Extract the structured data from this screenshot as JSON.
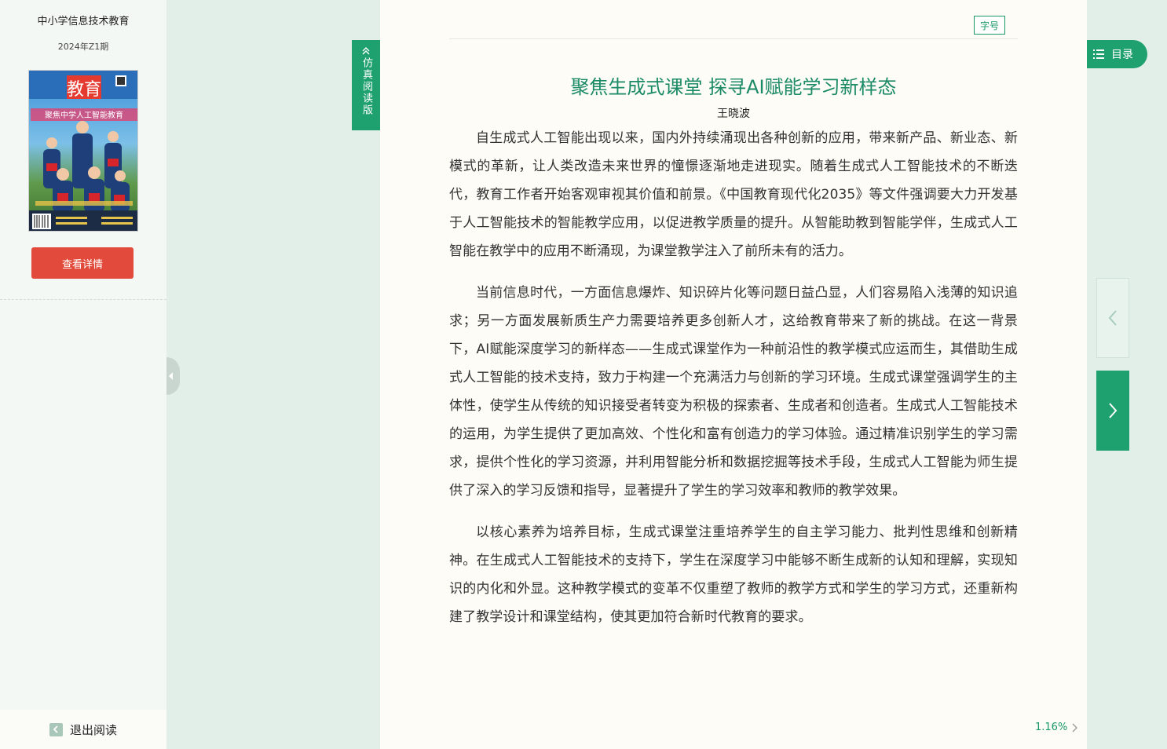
{
  "sidebar": {
    "magazine_title": "中小学信息技术教育",
    "issue": "2024年Z1期",
    "cover_masthead": "教育",
    "cover_headline": "聚焦中学人工智能教育",
    "detail_button": "查看详情",
    "exit_label": "退出阅读"
  },
  "simulated_tab": {
    "label": "仿真阅读版"
  },
  "toolbar": {
    "font_size_label": "字号",
    "toc_label": "目录"
  },
  "article": {
    "title": "聚焦生成式课堂 探寻AI赋能学习新样态",
    "author": "王晓波",
    "paragraphs": [
      "自生成式人工智能出现以来，国内外持续涌现出各种创新的应用，带来新产品、新业态、新模式的革新，让人类改造未来世界的憧憬逐渐地走进现实。随着生成式人工智能技术的不断迭代，教育工作者开始客观审视其价值和前景。《中国教育现代化2035》等文件强调要大力开发基于人工智能技术的智能教学应用，以促进教学质量的提升。从智能助教到智能学伴，生成式人工智能在教学中的应用不断涌现，为课堂教学注入了前所未有的活力。",
      "当前信息时代，一方面信息爆炸、知识碎片化等问题日益凸显，人们容易陷入浅薄的知识追求；另一方面发展新质生产力需要培养更多创新人才，这给教育带来了新的挑战。在这一背景下，AI赋能深度学习的新样态——生成式课堂作为一种前沿性的教学模式应运而生，其借助生成式人工智能的技术支持，致力于构建一个充满活力与创新的学习环境。生成式课堂强调学生的主体性，使学生从传统的知识接受者转变为积极的探索者、生成者和创造者。生成式人工智能技术的运用，为学生提供了更加高效、个性化和富有创造力的学习体验。通过精准识别学生的学习需求，提供个性化的学习资源，并利用智能分析和数据挖掘等技术手段，生成式人工智能为师生提供了深入的学习反馈和指导，显著提升了学生的学习效率和教师的教学效果。",
      "以核心素养为培养目标，生成式课堂注重培养学生的自主学习能力、批判性思维和创新精神。在生成式人工智能技术的支持下，学生在深度学习中能够不断生成新的认知和理解，实现知识的内化和外显。这种教学模式的变革不仅重塑了教师的教学方式和学生的学习方式，还重新构建了教学设计和课堂结构，使其更加符合新时代教育的要求。"
    ]
  },
  "progress": {
    "percent_label": "1.16%"
  },
  "colors": {
    "accent_green": "#1fa06f",
    "title_green": "#1b8a66",
    "detail_red": "#e24b3b",
    "background": "#e2efe8"
  }
}
